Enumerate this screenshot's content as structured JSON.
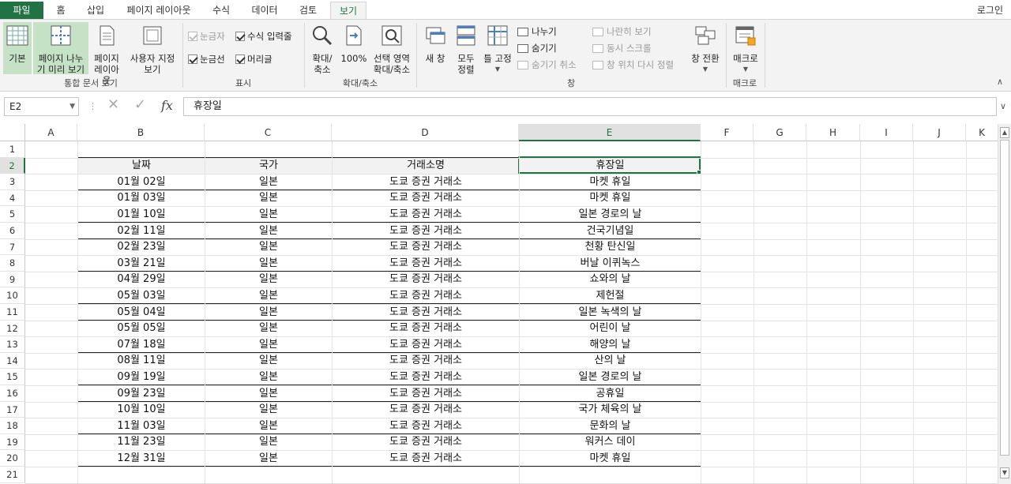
{
  "tabs": [
    "파일",
    "홈",
    "삽입",
    "페이지 레이아웃",
    "수식",
    "데이터",
    "검토",
    "보기"
  ],
  "active_tab": "보기",
  "login": "로그인",
  "ribbon": {
    "workbook_views": {
      "normal": "기본",
      "page_break_1": "페이지 나누",
      "page_break_2": "기 미리 보기",
      "page_layout_1": "페이지",
      "page_layout_2": "레이아웃",
      "custom_1": "사용자 지정",
      "custom_2": "보기",
      "label": "통합 문서 보기"
    },
    "show": {
      "ruler": "눈금자",
      "formula_bar": "수식 입력줄",
      "gridlines": "눈금선",
      "headings": "머리글",
      "label": "표시"
    },
    "zoom": {
      "zoom_1": "확대/",
      "zoom_2": "축소",
      "hundred": "100%",
      "selection_1": "선택 영역",
      "selection_2": "확대/축소",
      "label": "확대/축소"
    },
    "window": {
      "new_window": "새 창",
      "arrange_1": "모두",
      "arrange_2": "정렬",
      "freeze": "틀 고정",
      "split": "나누기",
      "hide": "숨기기",
      "unhide": "숨기기 취소",
      "side_by_side": "나란히 보기",
      "sync_scroll": "동시 스크롤",
      "reset_pos": "창 위치 다시 정렬",
      "switch": "창 전환",
      "label": "창"
    },
    "macros": {
      "macros": "매크로",
      "label": "매크로"
    }
  },
  "formula_bar": {
    "name_box": "E2",
    "fx": "fx",
    "content": "휴장일"
  },
  "columns": [
    "A",
    "B",
    "C",
    "D",
    "E",
    "F",
    "G",
    "H",
    "I",
    "J",
    "K"
  ],
  "rows": [
    "1",
    "2",
    "3",
    "4",
    "5",
    "6",
    "7",
    "8",
    "9",
    "10",
    "11",
    "12",
    "13",
    "14",
    "15",
    "16",
    "17",
    "18",
    "19",
    "20",
    "21"
  ],
  "table": {
    "headers": [
      "날짜",
      "국가",
      "거래소명",
      "휴장일"
    ],
    "rows": [
      [
        "01월 02일",
        "일본",
        "도쿄 증권 거래소",
        "마켓 휴일"
      ],
      [
        "01월 03일",
        "일본",
        "도쿄 증권 거래소",
        "마켓 휴일"
      ],
      [
        "01월 10일",
        "일본",
        "도쿄 증권 거래소",
        "일본 경로의 날"
      ],
      [
        "02월 11일",
        "일본",
        "도쿄 증권 거래소",
        "건국기념일"
      ],
      [
        "02월 23일",
        "일본",
        "도쿄 증권 거래소",
        "천황 탄신일"
      ],
      [
        "03월 21일",
        "일본",
        "도쿄 증권 거래소",
        "버날 이퀴녹스"
      ],
      [
        "04월 29일",
        "일본",
        "도쿄 증권 거래소",
        "쇼와의 날"
      ],
      [
        "05월 03일",
        "일본",
        "도쿄 증권 거래소",
        "제헌절"
      ],
      [
        "05월 04일",
        "일본",
        "도쿄 증권 거래소",
        "일본 녹색의 날"
      ],
      [
        "05월 05일",
        "일본",
        "도쿄 증권 거래소",
        "어린이 날"
      ],
      [
        "07월 18일",
        "일본",
        "도쿄 증권 거래소",
        "해양의 날"
      ],
      [
        "08월 11일",
        "일본",
        "도쿄 증권 거래소",
        "산의 날"
      ],
      [
        "09월 19일",
        "일본",
        "도쿄 증권 거래소",
        "일본 경로의 날"
      ],
      [
        "09월 23일",
        "일본",
        "도쿄 증권 거래소",
        "공휴일"
      ],
      [
        "10월 10일",
        "일본",
        "도쿄 증권 거래소",
        "국가 체육의 날"
      ],
      [
        "11월 03일",
        "일본",
        "도쿄 증권 거래소",
        "문화의 날"
      ],
      [
        "11월 23일",
        "일본",
        "도쿄 증권 거래소",
        "워커스 데이"
      ],
      [
        "12월 31일",
        "일본",
        "도쿄 증권 거래소",
        "마켓 휴일"
      ]
    ]
  },
  "colors": {
    "accent": "#217346",
    "ribbon_bg": "#f3f3f3",
    "selected_btn": "#c6e2c6"
  }
}
